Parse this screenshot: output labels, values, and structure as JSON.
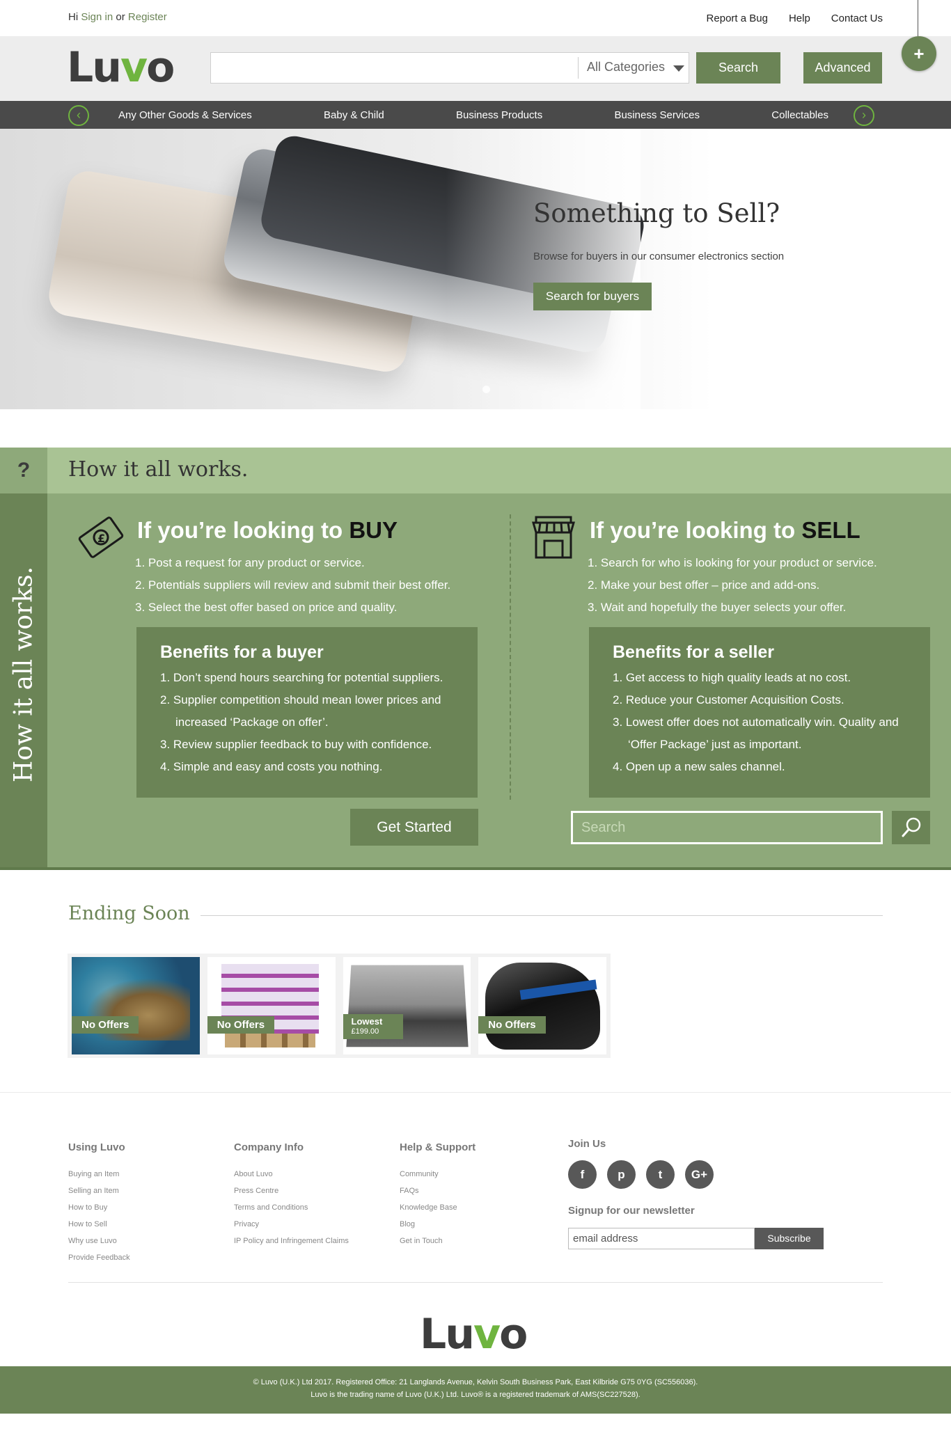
{
  "topbar": {
    "greeting_prefix": "Hi",
    "sign_in": "Sign in",
    "or": "or",
    "register": "Register",
    "links": [
      "Report a Bug",
      "Help",
      "Contact Us"
    ]
  },
  "header": {
    "logo_text": "Luvo",
    "search_placeholder": "",
    "category_selected": "All Categories",
    "search_button": "Search",
    "advanced_button": "Advanced",
    "fab_icon": "+"
  },
  "nav": {
    "items": [
      "Any Other Goods & Services",
      "Baby & Child",
      "Business Products",
      "Business Services",
      "Collectables"
    ]
  },
  "hero": {
    "title": "Something to Sell?",
    "subtitle": "Browse for buyers in our consumer electronics section",
    "button": "Search for buyers"
  },
  "how": {
    "question_mark": "?",
    "title": "How it all works.",
    "side_text": "How it all works.",
    "buy": {
      "title_prefix": "If you’re looking to",
      "title_emph": "BUY",
      "steps": [
        "1. Post a request for any product or service.",
        "2. Potentials suppliers will review and submit their best offer.",
        "3. Select the best offer based on price and quality."
      ],
      "benefits_title": "Benefits for a buyer",
      "benefits": [
        "1. Don’t spend hours searching for potential suppliers.",
        "2. Supplier competition should mean lower prices and increased ‘Package on offer’.",
        "3. Review supplier feedback to buy with confidence.",
        "4. Simple and easy and costs you nothing."
      ],
      "button": "Get Started"
    },
    "sell": {
      "title_prefix": "If you’re looking to",
      "title_emph": "SELL",
      "steps": [
        "1. Search for who is looking for your product or service.",
        "2. Make your best offer – price and add-ons.",
        "3. Wait and hopefully the buyer selects your offer."
      ],
      "benefits_title": "Benefits for a seller",
      "benefits": [
        "1. Get access to high quality leads at no cost.",
        "2. Reduce your Customer Acquisition Costs.",
        "3. Lowest offer does not automatically win. Quality and ‘Offer Package’ just as important.",
        "4. Open up a new sales channel."
      ],
      "search_placeholder": "Search"
    }
  },
  "ending": {
    "title": "Ending Soon",
    "cards": [
      {
        "badge": "No Offers",
        "price": ""
      },
      {
        "badge": "No Offers",
        "price": ""
      },
      {
        "badge": "Lowest",
        "price": "£199.00"
      },
      {
        "badge": "No Offers",
        "price": ""
      }
    ]
  },
  "footer": {
    "columns": [
      {
        "title": "Using Luvo",
        "items": [
          "Buying an Item",
          "Selling an Item",
          "How to Buy",
          "How to Sell",
          "Why use Luvo",
          "Provide Feedback"
        ]
      },
      {
        "title": "Company Info",
        "items": [
          "About Luvo",
          "Press Centre",
          "Terms and Conditions",
          "Privacy",
          "IP Policy and Infringement Claims"
        ]
      },
      {
        "title": "Help & Support",
        "items": [
          "Community",
          "FAQs",
          "Knowledge Base",
          "Blog",
          "Get in Touch"
        ]
      }
    ],
    "join_title": "Join Us",
    "socials": [
      "f",
      "p",
      "t",
      "G+"
    ],
    "newsletter_title": "Signup for our newsletter",
    "newsletter_placeholder": "email address",
    "subscribe": "Subscribe",
    "logo_text": "Luvo",
    "copyright_line1": "© Luvo (U.K.) Ltd 2017. Registered Office: 21 Langlands Avenue, Kelvin South Business Park, East Kilbride G75 0YG (SC556036).",
    "copyright_line2": "Luvo is the trading name of Luvo (U.K.) Ltd. Luvo® is a registered trademark of AMS(SC227528)."
  },
  "colors": {
    "brand_green": "#6b8456",
    "light_green": "#a9c394",
    "mid_green": "#8ea97a",
    "logo_heart": "#6fb43f",
    "nav_dark": "#4a4a4a"
  }
}
